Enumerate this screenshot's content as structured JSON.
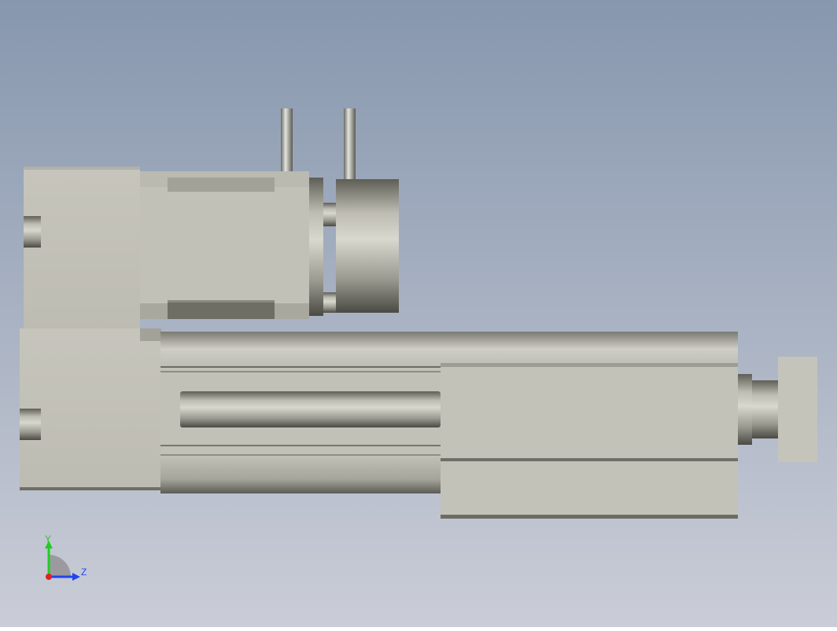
{
  "viewport": {
    "background_top": "#8a9ab0",
    "background_bottom": "#c8ccd6",
    "model_fill": "#c4c3ba",
    "model_shadow": "#6e6e66"
  },
  "triad": {
    "y_label": "Y",
    "z_label": "Z",
    "y_color": "#22cc22",
    "z_color": "#2244ee",
    "x_color": "#dd2222"
  }
}
